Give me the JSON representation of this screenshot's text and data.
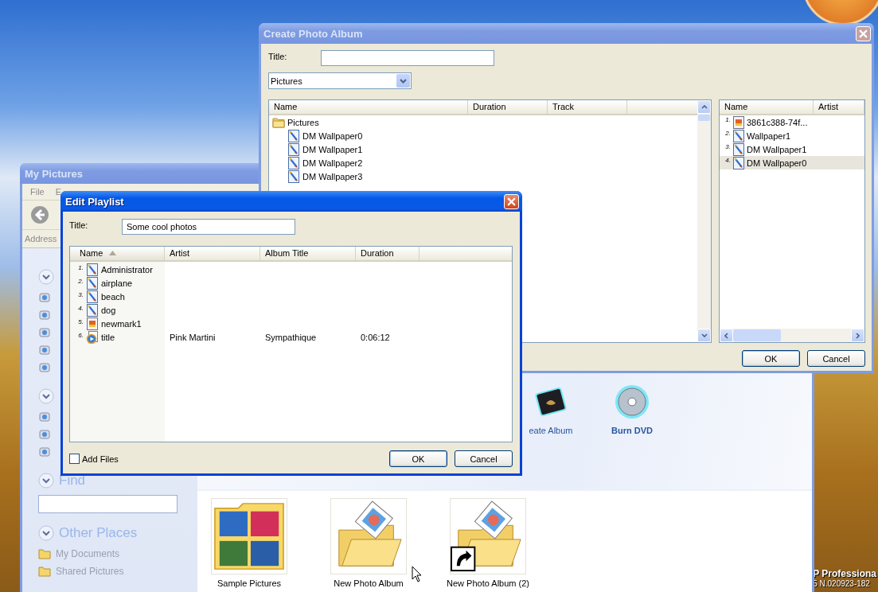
{
  "desktop": {
    "system_text": [
      "P Professiona",
      "5 N.020923-182"
    ]
  },
  "my_pictures": {
    "title": "My Pictures",
    "active": false,
    "menu": [
      "File",
      "E"
    ],
    "address_label": "Address",
    "find": {
      "title": "Find"
    },
    "other_places": {
      "title": "Other Places",
      "items": [
        "My Documents",
        "Shared Pictures"
      ]
    },
    "tasks": [
      {
        "label": "eate Album",
        "kind": "album"
      },
      {
        "label": "Burn DVD",
        "kind": "disc"
      }
    ],
    "files": [
      {
        "name": "Sample Pictures",
        "kind": "folder"
      },
      {
        "name": "New Photo Album",
        "kind": "album"
      },
      {
        "name": "New Photo Album (2)",
        "kind": "shortcut"
      }
    ]
  },
  "create_album": {
    "title": "Create Photo Album",
    "active": false,
    "title_label": "Title:",
    "source": "Pictures",
    "source_list": {
      "columns": [
        "Name",
        "Duration",
        "Track"
      ],
      "items": [
        {
          "name": "Pictures",
          "kind": "folder",
          "children": [
            {
              "name": "DM Wallpaper0",
              "kind": "image"
            },
            {
              "name": "DM Wallpaper1",
              "kind": "image"
            },
            {
              "name": "DM Wallpaper2",
              "kind": "image"
            },
            {
              "name": "DM Wallpaper3",
              "kind": "image"
            }
          ]
        }
      ]
    },
    "album_list": {
      "columns": [
        "Name",
        "Artist"
      ],
      "rows": [
        {
          "number": "1.",
          "name": "3861c388-74f...",
          "kind": "picture",
          "selected": false
        },
        {
          "number": "2.",
          "name": "Wallpaper1",
          "kind": "image",
          "selected": false
        },
        {
          "number": "3.",
          "name": "DM Wallpaper1",
          "kind": "image",
          "selected": false
        },
        {
          "number": "4.",
          "name": "DM Wallpaper0",
          "kind": "image",
          "selected": true
        }
      ]
    },
    "buttons": [
      "OK",
      "Cancel"
    ]
  },
  "edit_playlist": {
    "title": "Edit Playlist",
    "active": true,
    "title_label": "Title:",
    "title_value": "Some cool photos",
    "columns": [
      {
        "label": "Name",
        "sorted": true
      },
      {
        "label": "Artist",
        "sorted": false
      },
      {
        "label": "Album Title",
        "sorted": false
      },
      {
        "label": "Duration",
        "sorted": false
      }
    ],
    "rows": [
      {
        "number": "1.",
        "name": "Administrator",
        "kind": "image"
      },
      {
        "number": "2.",
        "name": "airplane",
        "kind": "image"
      },
      {
        "number": "3.",
        "name": "beach",
        "kind": "image"
      },
      {
        "number": "4.",
        "name": "dog",
        "kind": "image"
      },
      {
        "number": "5.",
        "name": "newmark1",
        "kind": "picture"
      },
      {
        "number": "6.",
        "name": "title",
        "kind": "media",
        "artist": "Pink Martini",
        "album": "Sympathique",
        "duration": "0:06:12"
      }
    ],
    "add_files": {
      "label": "Add Files",
      "checked": false
    },
    "buttons": [
      "OK",
      "Cancel"
    ]
  }
}
